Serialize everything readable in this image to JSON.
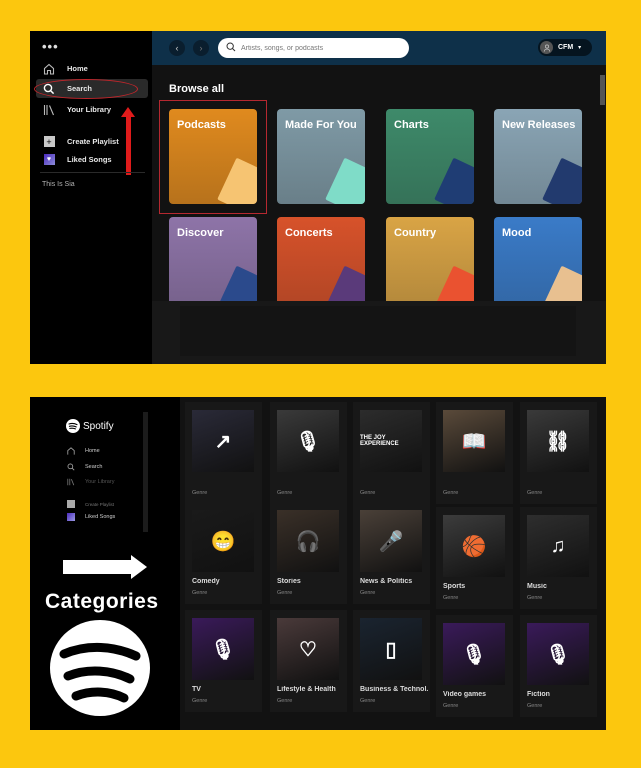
{
  "colors": {
    "background_yellow": "#fcc70e",
    "header_blue": "#0e3049",
    "highlight_red": "#c0262b",
    "arrow_red": "#e01b1b"
  },
  "top_screenshot": {
    "menu_dots": "•••",
    "sidebar": {
      "items": [
        {
          "label": "Home",
          "icon": "home-icon"
        },
        {
          "label": "Search",
          "icon": "search-icon",
          "active": true
        },
        {
          "label": "Your Library",
          "icon": "library-icon"
        }
      ],
      "actions": [
        {
          "label": "Create Playlist",
          "icon": "plus-icon"
        },
        {
          "label": "Liked Songs",
          "icon": "heart-icon"
        }
      ],
      "playlists": [
        "This Is Sia"
      ]
    },
    "header": {
      "back": "‹",
      "forward": "›",
      "search_placeholder": "Artists, songs, or podcasts",
      "search_value": "",
      "user": "CFM",
      "caret": "▾"
    },
    "section_title": "Browse all",
    "categories": [
      {
        "title": "Podcasts",
        "color": "#e08a1e",
        "selected": true
      },
      {
        "title": "Made For You",
        "color": "#7f9aa6"
      },
      {
        "title": "Charts",
        "color": "#3e8a6a"
      },
      {
        "title": "New Releases",
        "color": "#8aa5b5"
      },
      {
        "title": "Discover",
        "color": "#8e74a8"
      },
      {
        "title": "Concerts",
        "color": "#d7522a"
      },
      {
        "title": "Country",
        "color": "#d9a445"
      },
      {
        "title": "Mood",
        "color": "#3a7bc8"
      }
    ]
  },
  "bottom_screenshot": {
    "brand": "Spotify",
    "sidebar": {
      "items": [
        "Home",
        "Search",
        "Your Library"
      ],
      "actions": [
        "Create Playlist",
        "Liked Songs"
      ]
    },
    "annotation": "Categories",
    "genres": [
      {
        "name": "",
        "sub": "Genre",
        "icon": "trending-icon",
        "glyph": "↗"
      },
      {
        "name": "",
        "sub": "Genre",
        "icon": "microphone-icon",
        "glyph": "🎙"
      },
      {
        "name": "",
        "sub": "Genre",
        "icon": "book-icon",
        "glyph": "THE JOY EXPERIENCE"
      },
      {
        "name": "",
        "sub": "Genre",
        "icon": "open-book-icon",
        "glyph": "📖"
      },
      {
        "name": "",
        "sub": "Genre",
        "icon": "handcuffs-icon",
        "glyph": "⛓"
      },
      {
        "name": "Comedy",
        "sub": "Genre",
        "icon": "laughing-mouth-icon",
        "glyph": "😁"
      },
      {
        "name": "Stories",
        "sub": "Genre",
        "icon": "headphones-icon",
        "glyph": "🎧"
      },
      {
        "name": "News & Politics",
        "sub": "Genre",
        "icon": "microphone-icon",
        "glyph": "🎤"
      },
      {
        "name": "Sports",
        "sub": "Genre",
        "icon": "basketball-icon",
        "glyph": "🏀"
      },
      {
        "name": "Music",
        "sub": "Genre",
        "icon": "music-note-icon",
        "glyph": "♫"
      },
      {
        "name": "TV",
        "sub": "Genre",
        "icon": "microphone-icon",
        "glyph": "🎙"
      },
      {
        "name": "Lifestyle & Health",
        "sub": "Genre",
        "icon": "heart-pulse-icon",
        "glyph": "♡"
      },
      {
        "name": "Business & Technol...",
        "sub": "Genre",
        "icon": "tablet-icon",
        "glyph": "▯"
      },
      {
        "name": "Video games",
        "sub": "Genre",
        "icon": "microphone-icon",
        "glyph": "🎙"
      },
      {
        "name": "Fiction",
        "sub": "Genre",
        "icon": "microphone-icon",
        "glyph": "🎙"
      }
    ]
  }
}
